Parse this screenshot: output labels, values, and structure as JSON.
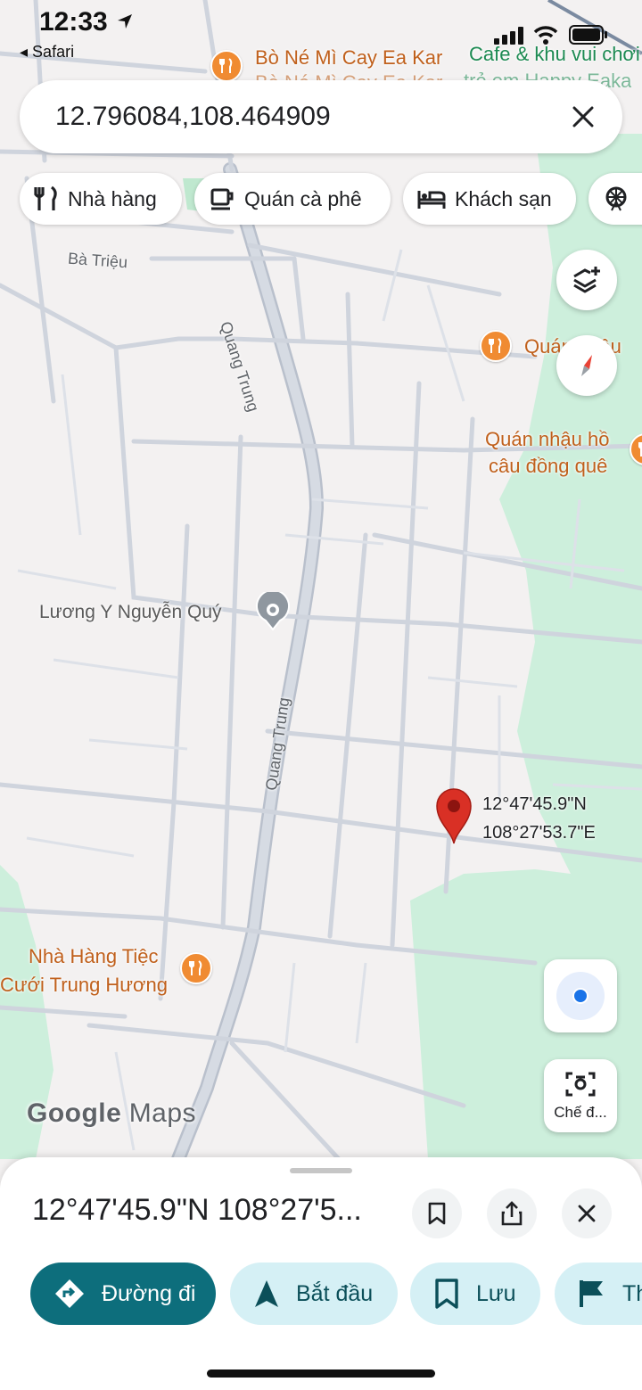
{
  "status_bar": {
    "time": "12:33",
    "back_app": "Safari"
  },
  "search": {
    "query": "12.796084,108.464909"
  },
  "chips": [
    {
      "label": "Nhà hàng",
      "icon": "restaurant-icon"
    },
    {
      "label": "Quán cà phê",
      "icon": "coffee-icon"
    },
    {
      "label": "Khách sạn",
      "icon": "hotel-icon"
    }
  ],
  "map": {
    "pois": [
      {
        "name": "Bò Né Mì Cay Ea Kar",
        "sub": "Bò Né Mì Cay Ea Kar",
        "icon": "restaurant-icon"
      },
      {
        "name": "Cafe & khu vui chơi",
        "sub": "trẻ em Happy Eaka",
        "icon": "cafe-icon"
      },
      {
        "name": "Quán nhậu",
        "icon": "restaurant-icon"
      },
      {
        "name": "Quán nhậu hồ",
        "sub": "câu đồng quê",
        "icon": "restaurant-icon"
      },
      {
        "name": "Lương Y Nguyễn Quý",
        "icon": "place-icon"
      },
      {
        "name": "Nhà Hàng Tiệc",
        "sub": "Cưới Trung Hương",
        "icon": "restaurant-icon"
      }
    ],
    "streets": [
      "Bà Triệu",
      "Quang Trung",
      "Quang Trung"
    ],
    "dropped_pin": {
      "lat": "12°47'45.9\"N",
      "lng": "108°27'53.7\"E"
    },
    "logo": {
      "google": "Google",
      "maps": "Maps"
    },
    "colors": {
      "land": "#f3f1f1",
      "park": "#cdefdc",
      "road": "#c9ced8",
      "pin": "#d93025"
    }
  },
  "controls": {
    "camera_label": "Chế đ..."
  },
  "sheet": {
    "title": "12°47'45.9\"N 108°27'5...",
    "actions": [
      {
        "label": "Đường đi",
        "icon": "directions-icon"
      },
      {
        "label": "Bắt đầu",
        "icon": "navigation-icon"
      },
      {
        "label": "Lưu",
        "icon": "bookmark-icon"
      },
      {
        "label": "Th",
        "icon": "flag-icon"
      }
    ]
  }
}
